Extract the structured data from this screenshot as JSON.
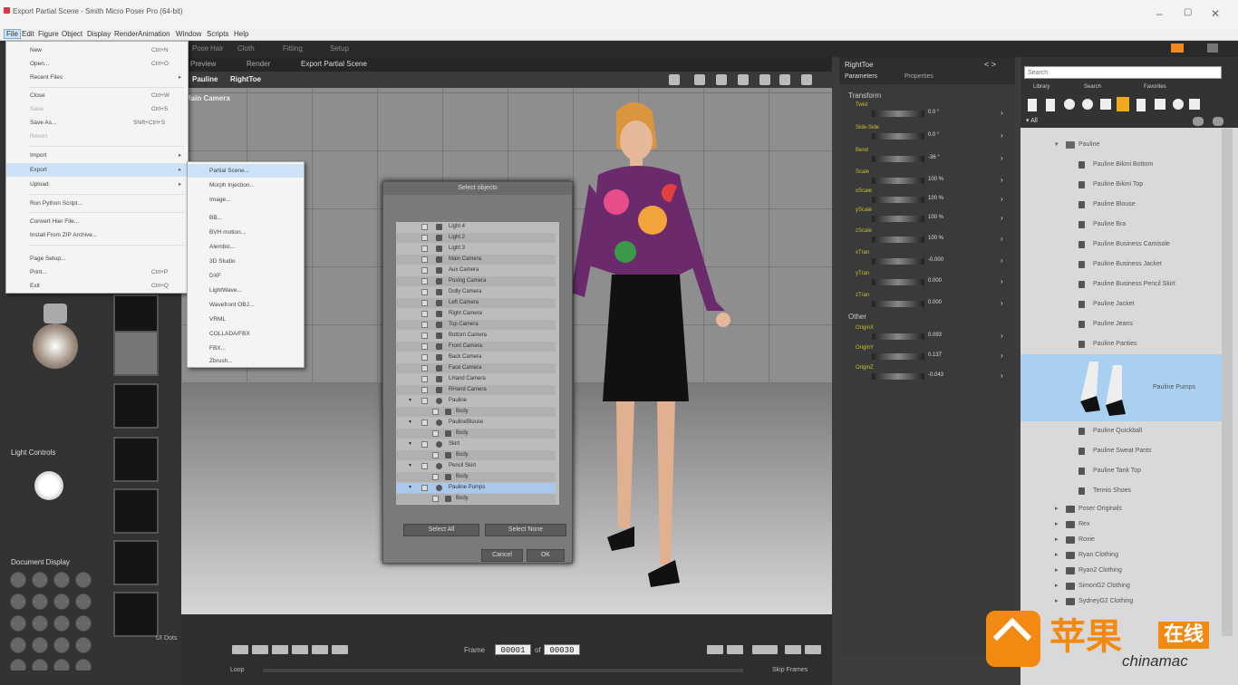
{
  "window": {
    "title": "Export Partial Scene - Smith Micro Poser Pro (64-bit)",
    "controls": [
      "–",
      "▢",
      "✕"
    ]
  },
  "menubar": [
    "File",
    "Edit",
    "Figure",
    "Object",
    "Display",
    "Render",
    "Animation",
    "Window",
    "Scripts",
    "Help"
  ],
  "room_tabs": [
    "Pose",
    "Hair",
    "Cloth",
    "Fitting",
    "Setup"
  ],
  "file_menu": [
    {
      "label": "New",
      "shortcut": "Ctrl+N"
    },
    {
      "label": "Open...",
      "shortcut": "Ctrl+O"
    },
    {
      "label": "Recent Files",
      "arrow": "▸"
    },
    {
      "label": "Close",
      "shortcut": "Ctrl+W"
    },
    {
      "label": "Save",
      "shortcut": "Ctrl+S"
    },
    {
      "label": "Save As...",
      "shortcut": "Shift+Ctrl+S"
    },
    {
      "label": "Revert"
    },
    {
      "label": "Import",
      "arrow": "▸"
    },
    {
      "label": "Export",
      "arrow": "▸"
    },
    {
      "label": "Upload",
      "arrow": "▸"
    },
    {
      "label": "Run Python Script..."
    },
    {
      "label": "Convert Hier File..."
    },
    {
      "label": "Install From ZIP Archive..."
    },
    {
      "label": "Page Setup..."
    },
    {
      "label": "Print...",
      "shortcut": "Ctrl+P"
    },
    {
      "label": "Exit",
      "shortcut": "Ctrl+Q"
    }
  ],
  "export_submenu": [
    "Partial Scene...",
    "Morph Injection...",
    "Image...",
    "BB...",
    "BVH motion...",
    "Alembic...",
    "3D Studio",
    "DXF",
    "LightWave...",
    "Wavefront OBJ...",
    "VRML",
    "COLLADA/FBX",
    "FBX...",
    "Zbrush..."
  ],
  "viewport": {
    "tabs": [
      "Preview",
      "Render",
      "Export Partial Scene"
    ],
    "figure_selector": "Pauline",
    "part_selector": "RightToe",
    "camera": "Main Camera"
  },
  "dialog": {
    "title": "Select objects",
    "rows": [
      "Light 4",
      "Light 2",
      "Light 3",
      "Main Camera",
      "Aux Camera",
      "Posing Camera",
      "Dolly Camera",
      "Left Camera",
      "Right Camera",
      "Top Camera",
      "Bottom Camera",
      "Front Camera",
      "Back Camera",
      "Face Camera",
      "LHand Camera",
      "RHand Camera",
      "Pauline",
      "Body",
      "PaulineBlouse",
      "Body",
      "Skirt",
      "Body",
      "Pencil Skirt",
      "Body",
      "Pauline Pumps",
      "Body"
    ],
    "select_all": "Select All",
    "select_none": "Select None",
    "cancel": "Cancel",
    "ok": "OK"
  },
  "left_panel": {
    "light_controls": "Light Controls",
    "document_display": "Document Display",
    "ui_dots": "UI Dots"
  },
  "params": {
    "part": "RightToe",
    "tabs": [
      "Parameters",
      "Properties"
    ],
    "section_transform": "Transform",
    "section_other": "Other",
    "dials": [
      {
        "name": "Twist",
        "value": "0.0 °"
      },
      {
        "name": "Side-Side",
        "value": "0.0 °"
      },
      {
        "name": "Bend",
        "value": "-36 °"
      },
      {
        "name": "Scale",
        "value": "100 %"
      },
      {
        "name": "xScale",
        "value": "100 %"
      },
      {
        "name": "yScale",
        "value": "100 %"
      },
      {
        "name": "zScale",
        "value": "100 %"
      },
      {
        "name": "xTran",
        "value": "-0.000"
      },
      {
        "name": "yTran",
        "value": "0.000"
      },
      {
        "name": "zTran",
        "value": "0.000"
      },
      {
        "name": "OriginX",
        "value": "0.093"
      },
      {
        "name": "OriginY",
        "value": "0.137"
      },
      {
        "name": "OriginZ",
        "value": "-0.043"
      }
    ]
  },
  "library": {
    "search_placeholder": "Search",
    "tabs": [
      "Library",
      "Search",
      "Favorites"
    ],
    "root": "All",
    "folder": "Pauline",
    "items": [
      "Pauline Bikini Bottom",
      "Pauline Bikini Top",
      "Pauline Blouse",
      "Pauline Bra",
      "Pauline Business Camisole",
      "Pauline Business Jacket",
      "Pauline Business Pencil Skirt",
      "Pauline Jacket",
      "Pauline Jeans",
      "Pauline Panties",
      "Pauline Pumps",
      "Pauline Quickball",
      "Pauline Sweat Pants",
      "Pauline Tank Top",
      "Tennis Shoes"
    ],
    "selected_index": 10,
    "folders": [
      "Poser Originals",
      "Rex",
      "Roxie",
      "Ryan Clothing",
      "Ryan2 Clothing",
      "SimonG2 Clothing",
      "SydneyG2 Clothing"
    ]
  },
  "timeline": {
    "frame_label": "Frame",
    "frame_current": "00001",
    "of_label": "of",
    "frame_total": "00030",
    "loop_label": "Loop",
    "skip_frames_label": "Skip Frames"
  },
  "watermark": {
    "cn": "苹果",
    "tag": "在线",
    "en": "chinamac"
  }
}
